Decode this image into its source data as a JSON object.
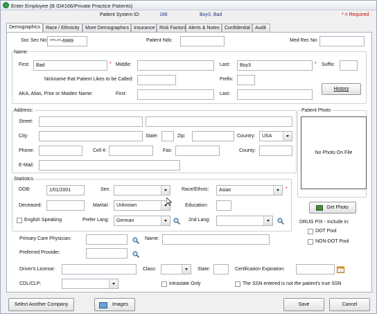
{
  "window": {
    "title": "Enter Employee (B  ID#166/Private Practice Patients)"
  },
  "header": {
    "system_id_label": "Patient System ID:",
    "system_id": "166",
    "patient_name": "Boy3, Bad",
    "required_note": "* = Required"
  },
  "tabs": [
    "Demographics",
    "Race / Ethnicity",
    "More Demographics",
    "Insurance",
    "Risk Factors",
    "Alerts & Notes",
    "Confidential",
    "Audit"
  ],
  "ids": {
    "ssn_label": "Soc Sec No:",
    "ssn_value": "***-**-6989",
    "ndx_label": "Patient Ndx:",
    "ndx_value": "",
    "medrec_label": "Med Rec No:",
    "medrec_value": ""
  },
  "name": {
    "section": "Name:",
    "first_label": "First:",
    "first": "Bad",
    "middle_label": "Middle:",
    "middle": "",
    "last_label": "Last:",
    "last": "Boy3",
    "suffix_label": "Suffix:",
    "suffix": "",
    "nickname_label": "Nickname that Patient Likes to be Called:",
    "nickname": "",
    "prefix_label": "Prefix:",
    "prefix": "",
    "aka_label": "AKA, Alias, Prior or Maiden Name:",
    "aka_first_label": "First:",
    "aka_first": "",
    "aka_last_label": "Last:",
    "aka_last": "",
    "history_button": "History"
  },
  "address": {
    "section": "Address:",
    "street_label": "Street:",
    "street1": "",
    "street2": "",
    "city_label": "City:",
    "city": "",
    "state_label": "State:",
    "state": "",
    "zip_label": "Zip:",
    "zip": "",
    "country_label": "Country:",
    "country": "USA",
    "phone_label": "Phone:",
    "phone": "",
    "cell_label": "Cell #:",
    "cell": "",
    "fax_label": "Fax:",
    "fax": "",
    "county_label": "County:",
    "county": "",
    "email_label": "E-Mail:",
    "email": ""
  },
  "photo": {
    "section": "Patient Photo",
    "placeholder": "No Photo On File",
    "get_photo_button": "Get Photo"
  },
  "drugfix": {
    "title": "DRUG PIX - Include in:",
    "dot_pool": "DOT Pool",
    "nondot_pool": "NON-DOT Pool"
  },
  "statistics": {
    "section": "Statistics",
    "dob_label": "DOB:",
    "dob": "1/01/2001",
    "sex_label": "Sex:",
    "sex": "",
    "race_label": "Race/Ethnic:",
    "race": "Asian",
    "deceased_label": "Deceased:",
    "deceased": "",
    "marital_label": "Marital:",
    "marital": "Unknown",
    "education_label": "Education:",
    "education": "",
    "english_label": "English Speaking",
    "prefer_lang_label": "Prefer Lang:",
    "prefer_lang": "German",
    "second_lang_label": "2nd Lang:",
    "second_lang": ""
  },
  "care": {
    "pcp_label": "Primary Care Physician:",
    "pcp": "",
    "name_label": "Name:",
    "name_value": "",
    "preferred_label": "Preferred Provider:",
    "preferred": ""
  },
  "license": {
    "dl_label": "Driver's License:",
    "dl": "",
    "class_label": "Class:",
    "class_value": "",
    "state_label": "State:",
    "state": "",
    "cert_label": "Certification Expiration:",
    "cert": "",
    "cdl_label": "CDL/CLP:",
    "cdl": "",
    "intrastate_label": "Intrastate Only",
    "ssn_note": "The SSN entered is not the patient's true SSN"
  },
  "footer": {
    "select_company": "Select Another Company",
    "images": "Images",
    "save": "Save",
    "cancel": "Cancel"
  },
  "colors": {
    "required": "#cc0000",
    "id_blue": "#1a2e8c"
  }
}
